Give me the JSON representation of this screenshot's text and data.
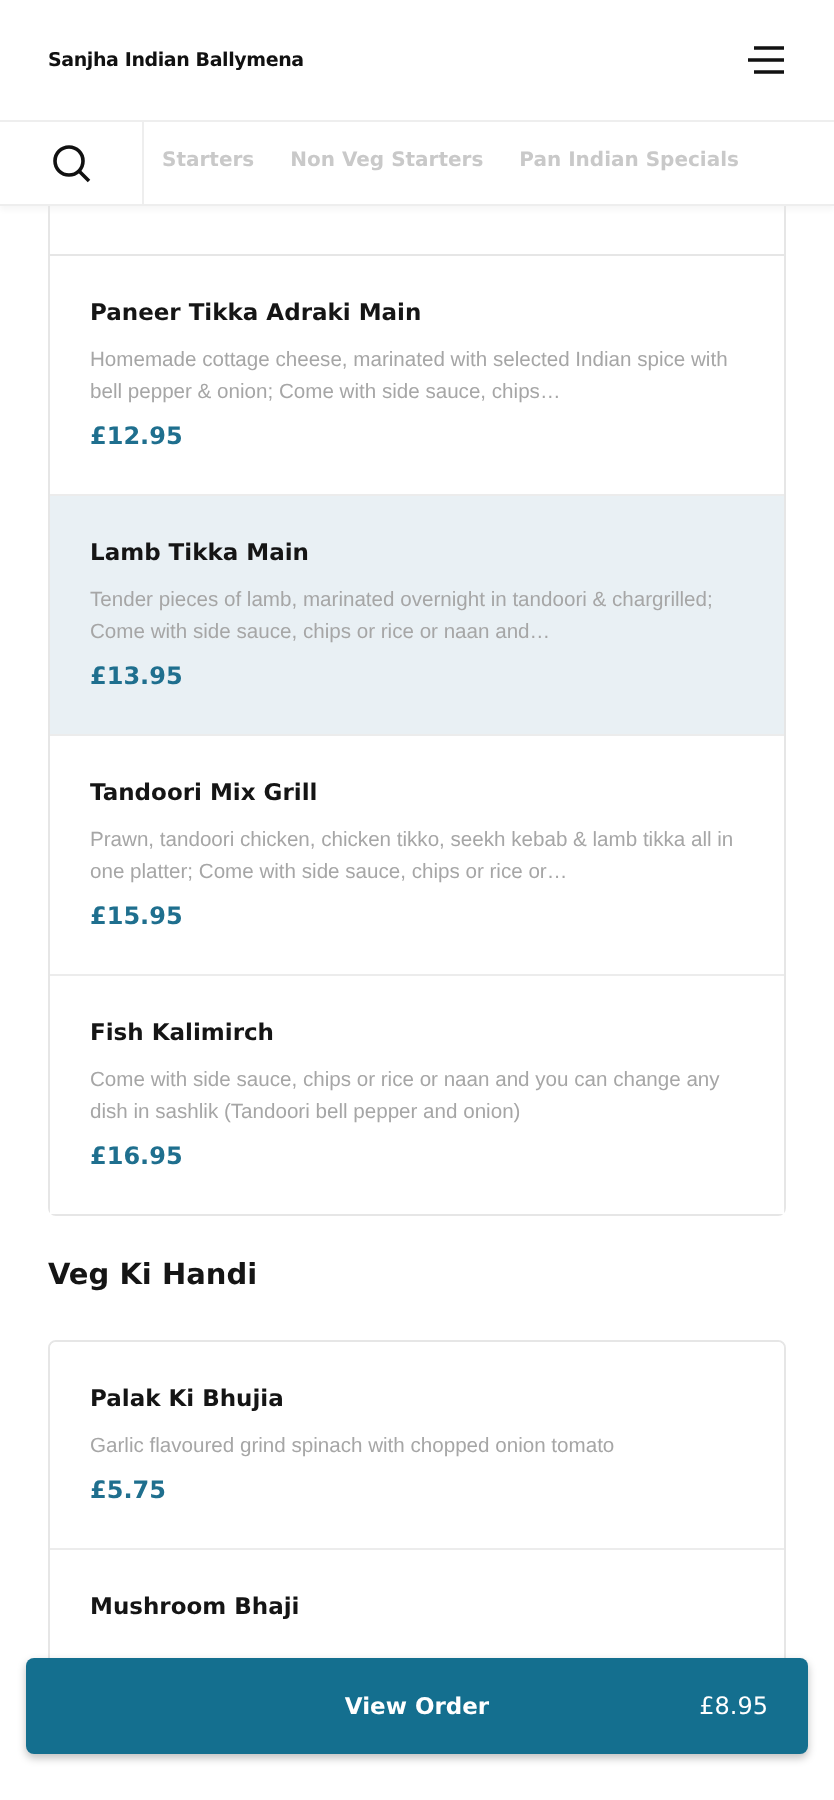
{
  "header": {
    "title": "Sanjha Indian Ballymena"
  },
  "tabs": [
    {
      "label": "Starters",
      "selected": false
    },
    {
      "label": "Non Veg Starters",
      "selected": false
    },
    {
      "label": "Pan Indian Specials",
      "selected": false
    }
  ],
  "sections": [
    {
      "items": [
        {
          "name": "Paneer Tikka Adraki Main",
          "description": "Homemade cottage cheese, marinated with selected Indian spice with bell pepper & onion; Come with side sauce, chips…",
          "price": "£12.95",
          "selected": false
        },
        {
          "name": "Lamb Tikka Main",
          "description": "Tender pieces of lamb, marinated overnight in tandoori & chargrilled; Come with side sauce, chips or rice or naan and…",
          "price": "£13.95",
          "selected": true
        },
        {
          "name": "Tandoori Mix Grill",
          "description": "Prawn, tandoori chicken, chicken tikko, seekh kebab & lamb tikka all in one platter; Come with side sauce, chips or rice or…",
          "price": "£15.95",
          "selected": false
        },
        {
          "name": "Fish Kalimirch",
          "description": "Come with side sauce, chips or rice or naan and you can change any dish in sashlik (Tandoori bell pepper and onion)",
          "price": "£16.95",
          "selected": false
        }
      ]
    },
    {
      "title": "Veg Ki Handi",
      "items": [
        {
          "name": "Palak Ki Bhujia",
          "description": "Garlic flavoured grind spinach with chopped onion tomato",
          "price": "£5.75",
          "selected": false
        },
        {
          "name": "Mushroom Bhaji",
          "selected": false
        }
      ]
    }
  ],
  "order_button": {
    "label": "View Order",
    "total": "£8.95"
  }
}
